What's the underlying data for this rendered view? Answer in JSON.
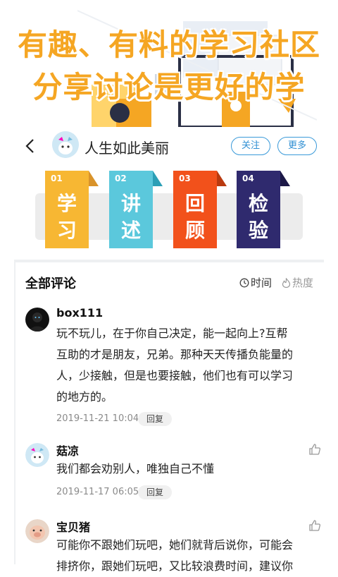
{
  "promo": {
    "line1": "有趣、有料的学习社区",
    "line2": "分享讨论是更好的学"
  },
  "header": {
    "username": "人生如此美丽",
    "follow_label": "关注",
    "more_label": "更多"
  },
  "steps": [
    {
      "num": "01",
      "char1": "学",
      "char2": "习",
      "color": "#f7b733"
    },
    {
      "num": "02",
      "char1": "讲",
      "char2": "述",
      "color": "#5bc8dc"
    },
    {
      "num": "03",
      "char1": "回",
      "char2": "顾",
      "color": "#f2511b"
    },
    {
      "num": "04",
      "char1": "检",
      "char2": "验",
      "color": "#2f2a6e"
    }
  ],
  "comments_section": {
    "title": "全部评论",
    "sort_time": "时间",
    "sort_hot": "热度"
  },
  "comments": [
    {
      "user": "box111",
      "lines": [
        "玩不玩儿，在于你自己决定，能一起向上?互帮",
        "互助的才是朋友，兄弟。那种天天传播负能量的",
        "人，少接触，但是也要接触，他们也有可以学习",
        "的地方的。"
      ],
      "time": "2019-11-21 10:04",
      "reply": "回复"
    },
    {
      "user": "菇凉",
      "lines": [
        "我们都会劝别人，唯独自己不懂"
      ],
      "time": "2019-11-17 06:05",
      "reply": "回复"
    },
    {
      "user": "宝贝猪",
      "lines": [
        "可能你不跟她们玩吧，她们就背后说你，可能会",
        "排挤你，跟她们玩吧，又比较浪费时间，建议你"
      ],
      "time": "",
      "reply": ""
    }
  ]
}
